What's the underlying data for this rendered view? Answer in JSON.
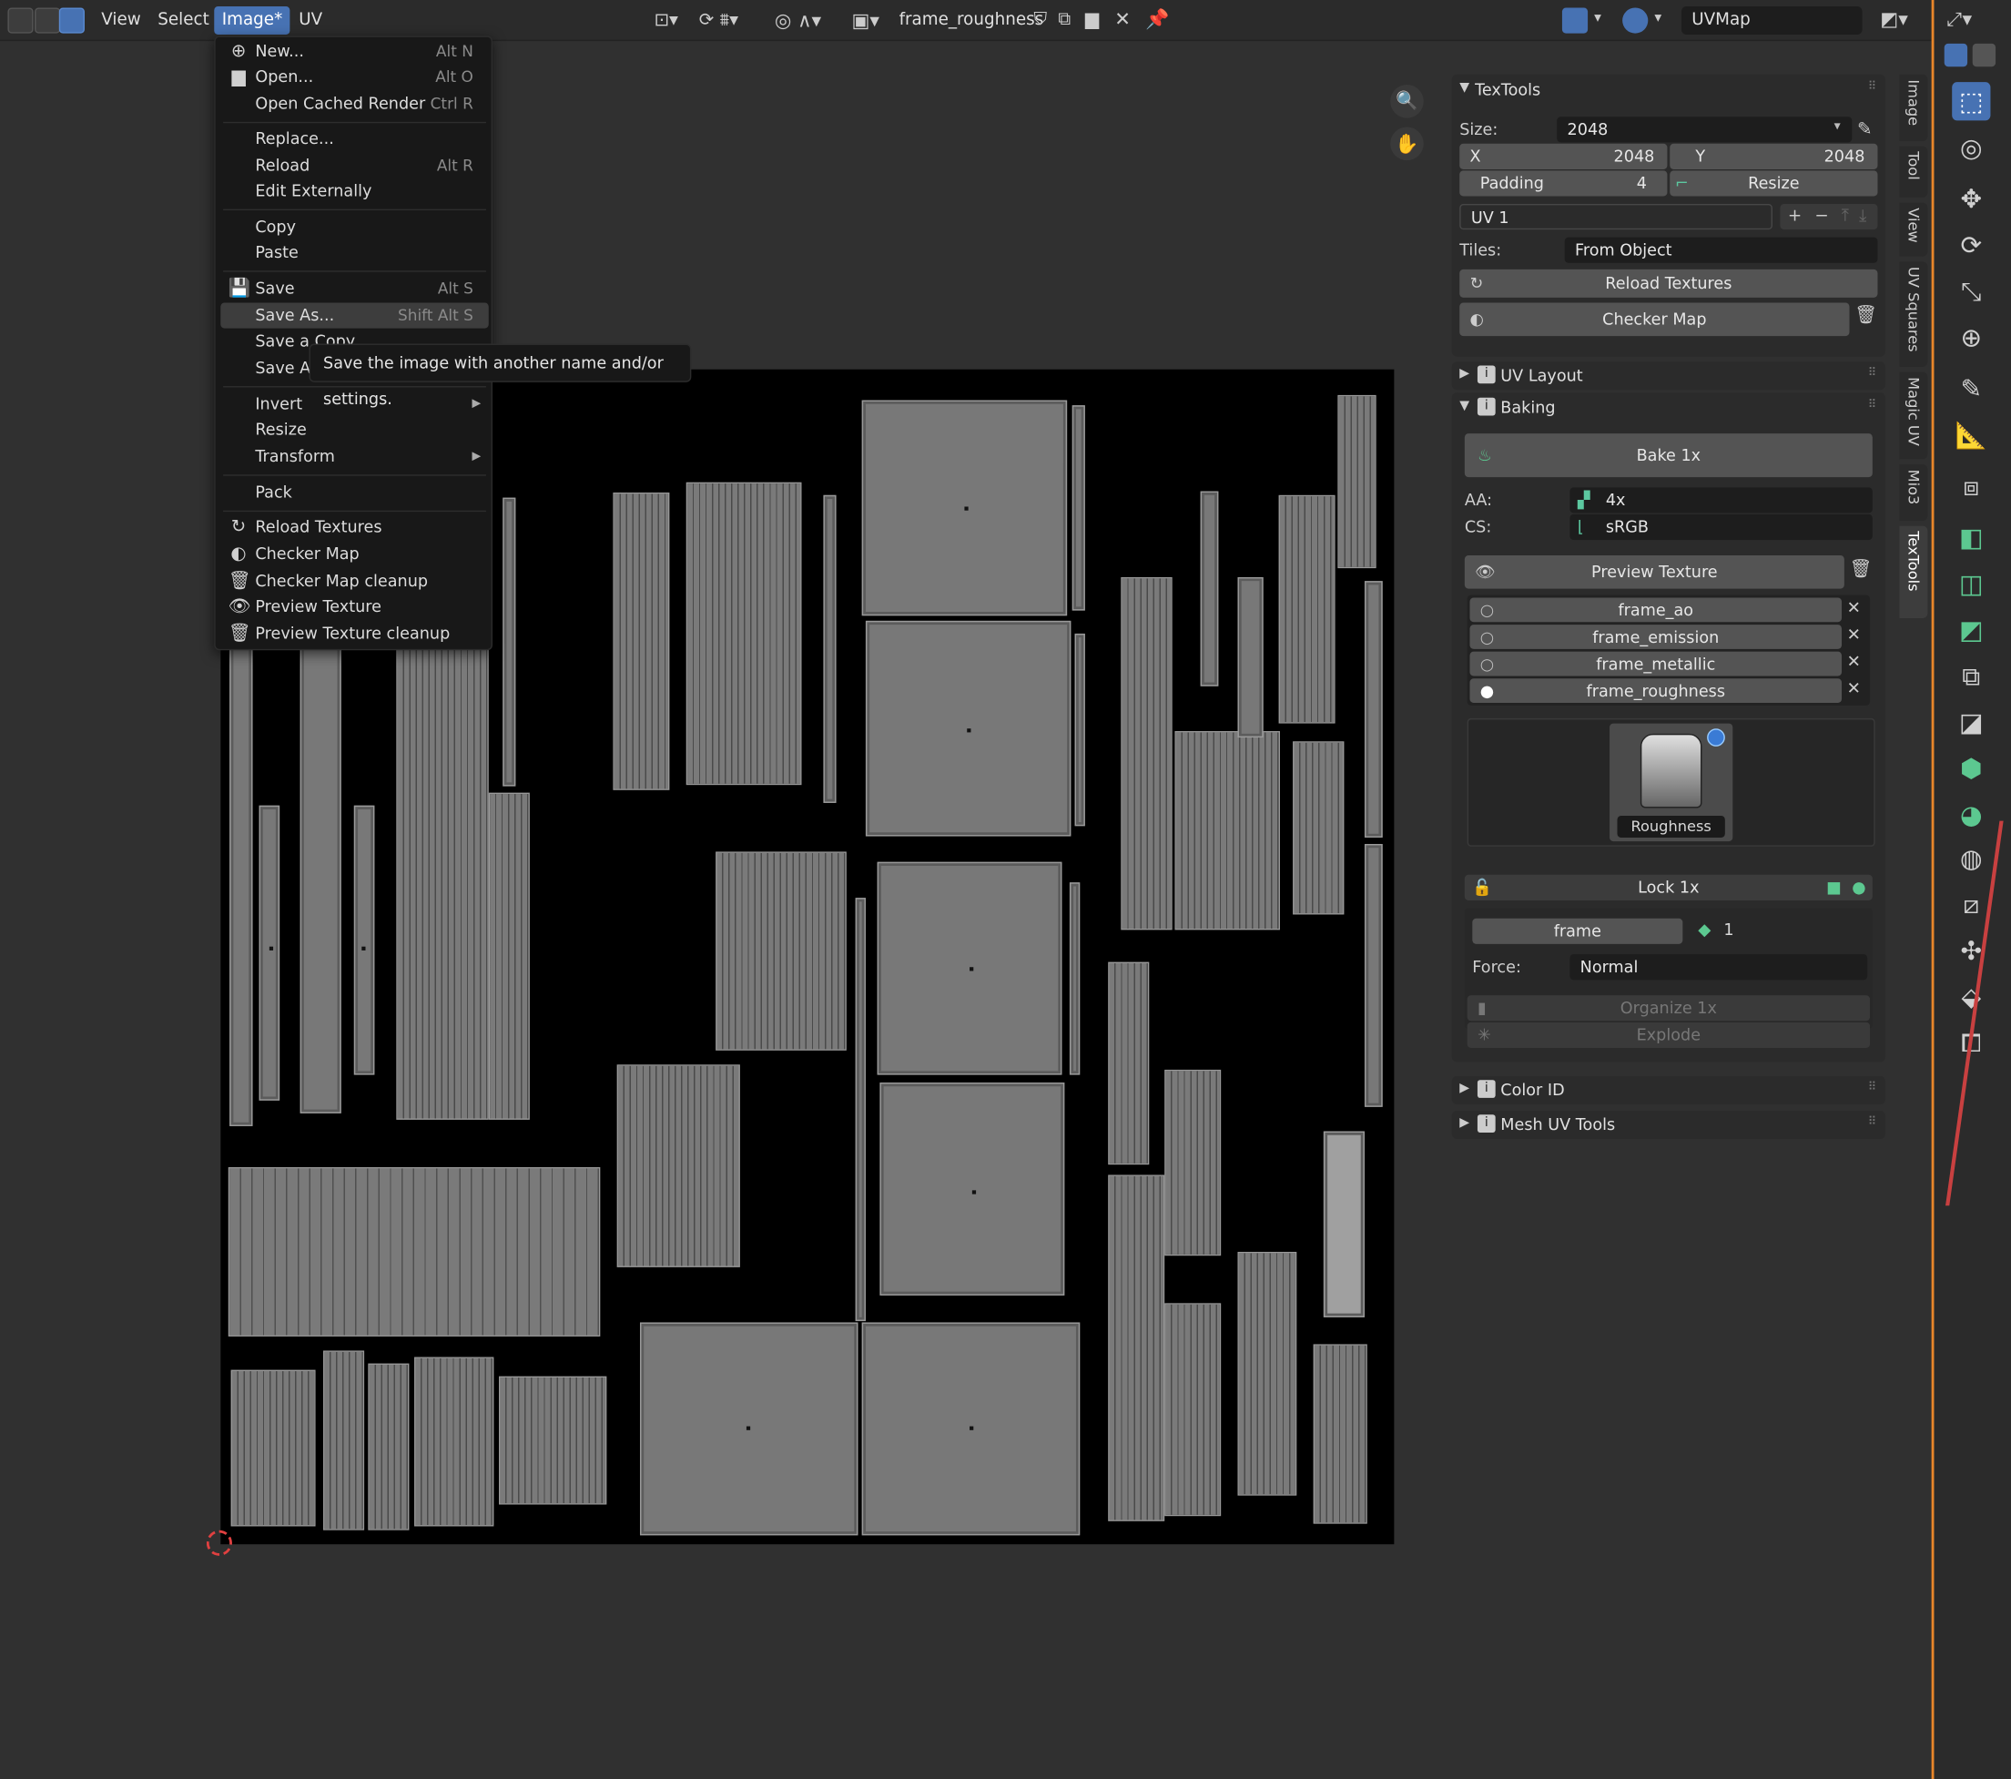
{
  "header": {
    "menus": [
      "View",
      "Select",
      "Image*",
      "UV"
    ],
    "image_name": "frame_roughness",
    "uvmap": "UVMap"
  },
  "image_menu": {
    "items": [
      {
        "label": "New...",
        "shortcut": "Alt N",
        "icon": "new-image-icon"
      },
      {
        "label": "Open...",
        "shortcut": "Alt O",
        "icon": "folder-icon"
      },
      {
        "label": "Open Cached Render",
        "shortcut": "Ctrl R"
      },
      {
        "label": "Replace..."
      },
      {
        "label": "Reload",
        "shortcut": "Alt R"
      },
      {
        "label": "Edit Externally"
      },
      {
        "label": "Copy"
      },
      {
        "label": "Paste"
      },
      {
        "label": "Save",
        "shortcut": "Alt S",
        "icon": "save-icon"
      },
      {
        "label": "Save As...",
        "shortcut": "Shift Alt S"
      },
      {
        "label": "Save a Copy"
      },
      {
        "label": "Save Al"
      },
      {
        "label": "Invert"
      },
      {
        "label": "Resize"
      },
      {
        "label": "Transform"
      },
      {
        "label": "Pack"
      },
      {
        "label": "Reload Textures",
        "icon": "reload-icon"
      },
      {
        "label": "Checker Map",
        "icon": "checker-icon"
      },
      {
        "label": "Checker Map cleanup",
        "icon": "trash-icon"
      },
      {
        "label": "Preview Texture",
        "icon": "eye-icon"
      },
      {
        "label": "Preview Texture cleanup",
        "icon": "trash-icon"
      }
    ],
    "tooltip": "Save the image with another name and/or settings."
  },
  "textools": {
    "title": "TexTools",
    "size_label": "Size:",
    "size_value": "2048",
    "x_label": "X",
    "x_value": "2048",
    "y_label": "Y",
    "y_value": "2048",
    "padding_label": "Padding",
    "padding_value": "4",
    "resize_label": "Resize",
    "uv_channel": "UV 1",
    "tiles_label": "Tiles:",
    "tiles_value": "From Object",
    "reload_textures": "Reload Textures",
    "checker_map": "Checker Map"
  },
  "uv_layout": {
    "title": "UV Layout"
  },
  "baking": {
    "title": "Baking",
    "bake_button": "Bake 1x",
    "aa_label": "AA:",
    "aa_value": "4x",
    "cs_label": "CS:",
    "cs_value": "sRGB",
    "preview_texture": "Preview Texture",
    "bake_modes": [
      {
        "name": "frame_ao",
        "selected": false
      },
      {
        "name": "frame_emission",
        "selected": false
      },
      {
        "name": "frame_metallic",
        "selected": false
      },
      {
        "name": "frame_roughness",
        "selected": true
      }
    ],
    "thumbnail_label": "Roughness",
    "lock_label": "Lock 1x",
    "set_name": "frame",
    "set_count": "1",
    "force_label": "Force:",
    "force_value": "Normal",
    "organize_label": "Organize 1x",
    "explode_label": "Explode"
  },
  "color_id": {
    "title": "Color ID"
  },
  "mesh_uv_tools": {
    "title": "Mesh UV Tools"
  },
  "side_tabs": [
    "Image",
    "Tool",
    "View",
    "UV Squares",
    "Magic UV",
    "Mio3",
    "TexTools"
  ],
  "accent_color": "#4772b3",
  "highlight_orange": "#e8862a"
}
